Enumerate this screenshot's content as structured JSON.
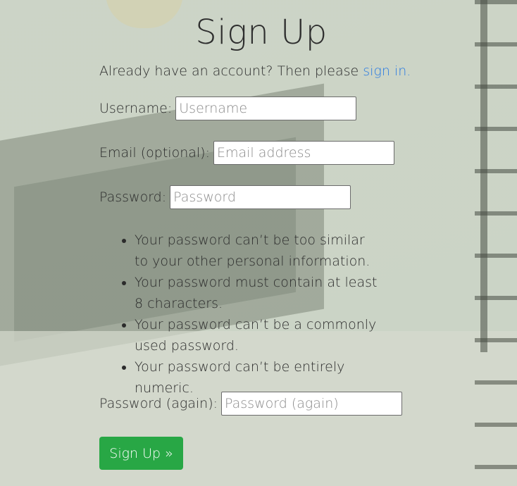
{
  "page": {
    "title": "Sign Up"
  },
  "intro": {
    "text": "Already have an account? Then please ",
    "link_label": "sign in."
  },
  "form": {
    "username": {
      "label": "Username:",
      "placeholder": "Username",
      "value": ""
    },
    "email": {
      "label": "Email (optional):",
      "placeholder": "Email address",
      "value": ""
    },
    "password1": {
      "label": "Password:",
      "placeholder": "Password",
      "value": ""
    },
    "password_help": [
      "Your password can’t be too similar to your other personal information.",
      "Your password must contain at least 8 characters.",
      "Your password can’t be a commonly used password.",
      "Your password can’t be entirely numeric."
    ],
    "password2": {
      "label": "Password (again):",
      "placeholder": "Password (again)",
      "value": ""
    },
    "submit_label": "Sign Up »"
  },
  "colors": {
    "link": "#2a7ae2",
    "button": "#28a745",
    "background_tint": "#cfd6c9"
  }
}
